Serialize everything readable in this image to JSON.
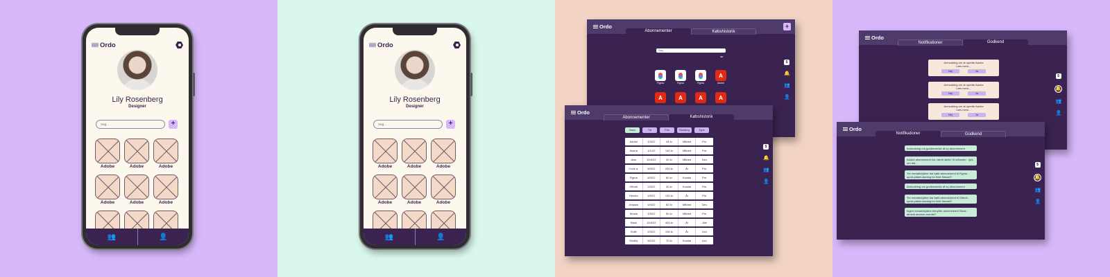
{
  "app": {
    "logo": "Ordo"
  },
  "phone": {
    "name": "Lily Rosenberg",
    "role": "Designer",
    "search_placeholder": "Søg...",
    "add_label": "+",
    "tiles": [
      "Adobe",
      "Adobe",
      "Adobe",
      "Adobe",
      "Adobe",
      "Adobe",
      "",
      "",
      ""
    ]
  },
  "win_subs": {
    "tabs": [
      "Abonnementer",
      "Købshistorik"
    ],
    "active_tab": "Abonnementer",
    "search_placeholder": "Søg...",
    "add_label": "+",
    "apps": [
      {
        "name": "Figma",
        "icon": "figma-icon"
      },
      {
        "name": "Figma",
        "icon": "figma-icon"
      },
      {
        "name": "Figma",
        "icon": "figma-icon"
      },
      {
        "name": "Adobe",
        "icon": "adobe-icon"
      },
      {
        "name": "",
        "icon": "adobe-icon"
      },
      {
        "name": "",
        "icon": "adobe-icon"
      },
      {
        "name": "",
        "icon": "adobe-icon"
      },
      {
        "name": "",
        "icon": "adobe-icon"
      }
    ]
  },
  "win_hist": {
    "tabs": [
      "Abonnementer",
      "Købshistorik"
    ],
    "active_tab": "Købshistorik",
    "columns": [
      "Navn",
      "Tid",
      "Pris",
      "Betaling",
      "Type"
    ],
    "rows": [
      [
        "Adobe",
        "1/3/22",
        "44 kr",
        "Måned",
        "Pro."
      ],
      [
        "Asana",
        "1/1/22",
        "140 kr",
        "Måned",
        "Pre."
      ],
      [
        "Aws",
        "10/4/22",
        "30 kr",
        "Måned",
        "Dev."
      ],
      [
        "Code a.",
        "8/4/22",
        "200 kr",
        "År",
        "Pro."
      ],
      [
        "Figma",
        "8/3/22",
        "80 kr",
        "Kvartal",
        "Pre."
      ],
      [
        "Github",
        "2/3/22",
        "30 kr",
        "Kvartal",
        "Pre."
      ],
      [
        "Heroku",
        "4/5/22",
        "130 kr",
        "År",
        "Pre."
      ],
      [
        "Jetpack",
        "4/4/22",
        "82 kr",
        "Måned",
        "Dev."
      ],
      [
        "Kinsta",
        "1/5/22",
        "50 kr",
        "Måned",
        "Pre."
      ],
      [
        "Slack",
        "10/3/22",
        "400 kr",
        "År",
        "Alle"
      ],
      [
        "Sulle",
        "2/3/22",
        "108 kr",
        "År",
        "Led."
      ],
      [
        "Shotify",
        "9/2/22",
        "70 kr",
        "Kvartal",
        "Led."
      ]
    ]
  },
  "win_notif": {
    "tabs": [
      "Notifikationer",
      "Godkend"
    ],
    "active_tab": "Notifikationer",
    "notes": [
      "Anmodning om godkendelse af ny abonnement",
      "Adobe abonnement har været aktivt i 6 måneder - tjek om det...",
      "Tre medarbejdere har købt abonnement til Figma - opret pakke-løsning for hele firmaet?",
      "Anmodning om godkendelse af ny abonnement",
      "Tre medarbejdere har købt abonnement til Github - opret pakke-løsning for hele firmaet?",
      "Ingen medarbejdere benytter abonnement Slack - afmeld abonne-mentet?"
    ]
  },
  "win_approve": {
    "tabs": [
      "Notifikationer",
      "Godkend"
    ],
    "active_tab": "Godkend",
    "requests": [
      {
        "text": "Anmodning om at oprette Adobe",
        "more": "Læs mere...",
        "no": "Nej",
        "yes": "Ja"
      },
      {
        "text": "Anmodning om at oprette Adobe",
        "more": "Læs mere...",
        "no": "Nej",
        "yes": "Ja"
      },
      {
        "text": "Anmodning om at oprette Adobe",
        "more": "Læs mere...",
        "no": "Nej",
        "yes": "Ja"
      }
    ]
  },
  "colors": {
    "primary": "#3a2351",
    "accent": "#d8b8fb",
    "mint": "#d9f7ec",
    "peach": "#f2d3c4",
    "adobe": "#e02a13"
  }
}
